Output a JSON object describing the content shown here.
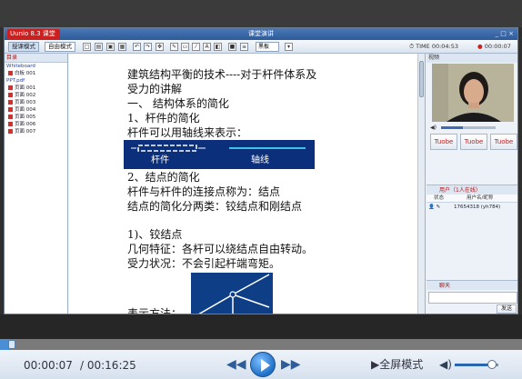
{
  "window": {
    "app_logo": "Uunio 8.3 课堂",
    "title": "课堂演讲",
    "controls": "_ □ ×"
  },
  "toolbar": {
    "mode_lecture": "授课模式",
    "mode_self": "自由模式",
    "select_value": "黑板",
    "time_label": "TIME",
    "time_value": "00:04:53",
    "rec_value": "00:00:07"
  },
  "left_panel": {
    "header": "目录",
    "items": [
      {
        "label": "Whiteboard",
        "type": "folder"
      },
      {
        "label": "白板 001",
        "type": "file"
      },
      {
        "label": "PPT.pdf",
        "type": "folder"
      },
      {
        "label": "页面 001",
        "type": "file"
      },
      {
        "label": "页面 002",
        "type": "file"
      },
      {
        "label": "页面 003",
        "type": "file"
      },
      {
        "label": "页面 004",
        "type": "file"
      },
      {
        "label": "页面 005",
        "type": "file"
      },
      {
        "label": "页面 006",
        "type": "file"
      },
      {
        "label": "页面 007",
        "type": "file"
      }
    ]
  },
  "document": {
    "title_line1": "建筑结构平衡的技术----对于杆件体系及",
    "title_line2": "受力的讲解",
    "section1": "一、  结构体系的简化",
    "sub1": "1、杆件的简化",
    "line1": "杆件可以用轴线来表示：",
    "diagram1_left": "杆件",
    "diagram1_right": "轴线",
    "sub2": "2、结点的简化",
    "line2": "杆件与杆件的连接点称为：结点",
    "line3": "结点的简化分两类：铰结点和刚结点",
    "sub3": "1)、铰结点",
    "line4": "几何特征：各杆可以绕结点自由转动。",
    "line5": "受力状况：不会引起杆端弯矩。",
    "line6": "表示方法："
  },
  "right_panel": {
    "video_header": "视频",
    "seat_labels": [
      "Tuobe",
      "Tuobe",
      "Tuobe"
    ],
    "users_header": "用户（1人在线）",
    "col_status": "状态",
    "col_name": "用户名/昵称",
    "user_name": "17654318 (yh784)",
    "chat_header": "聊天",
    "send_label": "发送"
  },
  "player": {
    "current_time": "00:00:07",
    "total_time": "/ 00:16:25",
    "fullscreen_label": "▶全屏模式",
    "progress_fraction": 0.02,
    "volume_fraction": 0.85
  }
}
